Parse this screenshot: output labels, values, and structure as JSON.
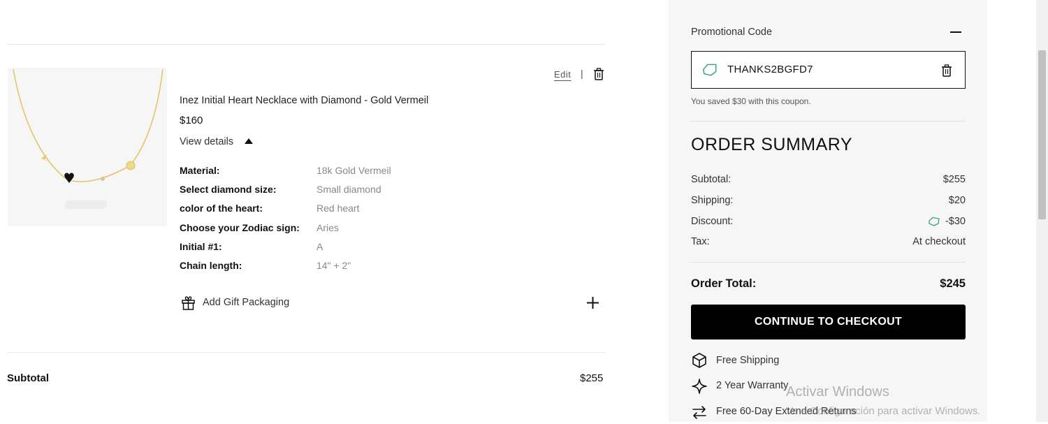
{
  "cart": {
    "item": {
      "name": "Inez Initial Heart Necklace with Diamond - Gold Vermeil",
      "price": "$160",
      "edit_label": "Edit",
      "separator": "|",
      "view_details_label": "View details",
      "details": [
        {
          "label": "Material:",
          "value": "18k Gold Vermeil"
        },
        {
          "label": "Select diamond size:",
          "value": "Small diamond"
        },
        {
          "label": "color of the heart:",
          "value": "Red heart"
        },
        {
          "label": "Choose your Zodiac sign:",
          "value": "Aries"
        },
        {
          "label": "Initial #1:",
          "value": "A"
        },
        {
          "label": "Chain length:",
          "value": "14\" + 2\""
        }
      ],
      "gift_label": "Add Gift Packaging",
      "image_icon": "necklace-product-image"
    },
    "subtotal_label": "Subtotal",
    "subtotal_value": "$255"
  },
  "summary": {
    "promo_label": "Promotional Code",
    "coupon_code": "THANKS2BGFD7",
    "saved_note": "You saved $30 with this coupon.",
    "heading": "ORDER SUMMARY",
    "rows": [
      {
        "label": "Subtotal:",
        "value": "$255"
      },
      {
        "label": "Shipping:",
        "value": "$20"
      },
      {
        "label": "Discount:",
        "value": "-$30"
      },
      {
        "label": "Tax:",
        "value": "At checkout"
      }
    ],
    "total_label": "Order Total:",
    "total_value": "$245",
    "checkout_label": "CONTINUE TO CHECKOUT",
    "perks": [
      {
        "icon": "box-icon",
        "label": "Free Shipping"
      },
      {
        "icon": "sparkle-icon",
        "label": "2 Year Warranty"
      },
      {
        "icon": "swap-arrows-icon",
        "label": "Free 60-Day Extended Returns"
      }
    ]
  },
  "watermark": {
    "line1": "Activar Windows",
    "line2": "Ve a Configuración para activar Windows."
  },
  "colors": {
    "accent_tag": "#3aa389",
    "button_bg": "#000000",
    "panel_bg": "#f6f6f6"
  }
}
